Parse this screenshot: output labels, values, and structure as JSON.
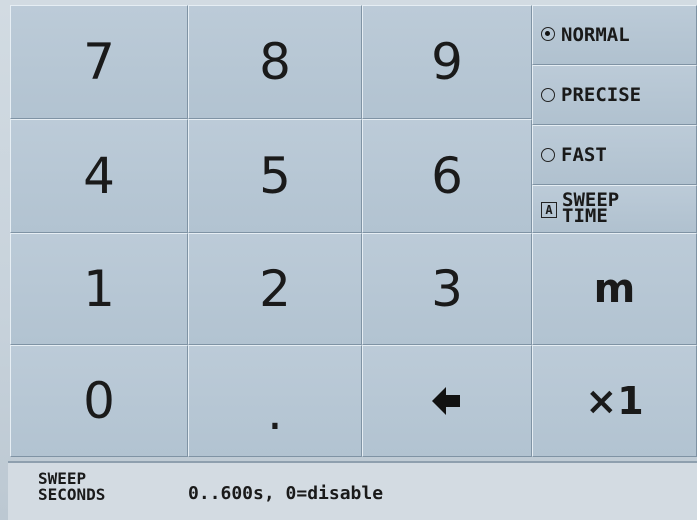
{
  "keypad": {
    "k7": "7",
    "k8": "8",
    "k9": "9",
    "k4": "4",
    "k5": "5",
    "k6": "6",
    "k1": "1",
    "k2": "2",
    "k3": "3",
    "k0": "0",
    "kdot": ".",
    "backspace_icon": "left-arrow-icon"
  },
  "side": {
    "normal": "NORMAL",
    "precise": "PRECISE",
    "fast": "FAST",
    "sweep_line1": "SWEEP",
    "sweep_line2": "TIME",
    "sweep_check": "A",
    "unit_m": "m",
    "unit_x1": "×1",
    "selected_mode": "NORMAL"
  },
  "status": {
    "label_line1": "SWEEP",
    "label_line2": "SECONDS",
    "hint": "0..600s, 0=disable"
  }
}
